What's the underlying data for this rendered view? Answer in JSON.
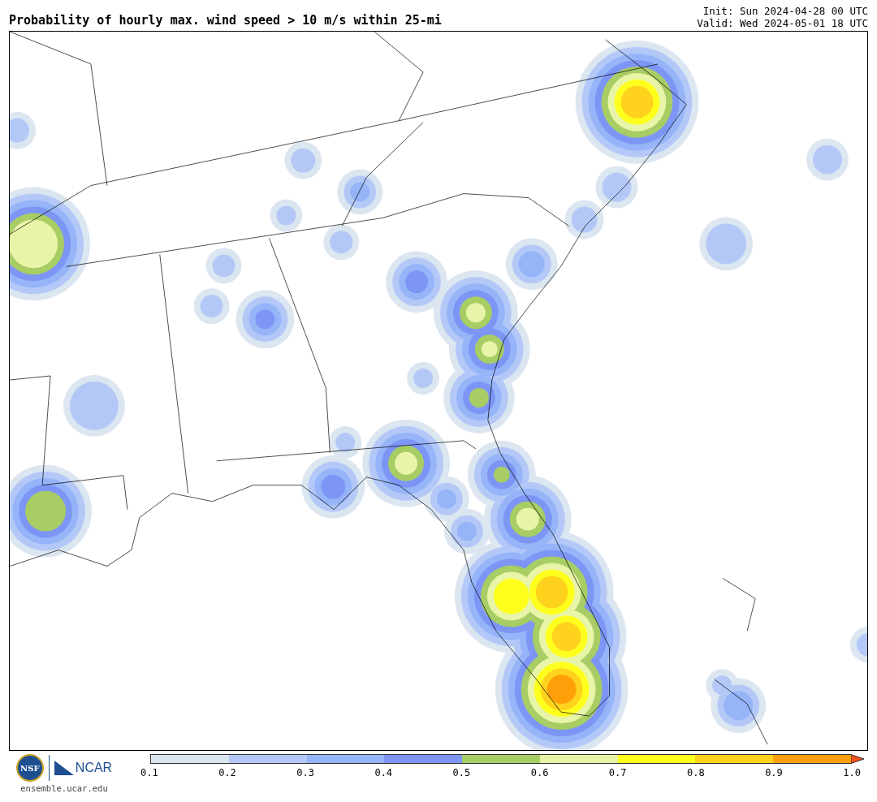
{
  "title": "Probability of hourly max. wind speed > 10 m/s within 25-mi",
  "init": "Init: Sun 2024-04-28 00 UTC",
  "valid": "Valid: Wed 2024-05-01 18 UTC",
  "logos": {
    "nsf": "NSF",
    "ncar": "NCAR",
    "site": "ensemble.ucar.edu"
  },
  "colorbar": {
    "bins": [
      {
        "kind": "block",
        "color": "#dbe6f0"
      },
      {
        "kind": "block",
        "color": "#b4c8f8"
      },
      {
        "kind": "block",
        "color": "#96b4f8"
      },
      {
        "kind": "block",
        "color": "#7d96f5"
      },
      {
        "kind": "block",
        "color": "#a8cd64"
      },
      {
        "kind": "block",
        "color": "#e8f5a8"
      },
      {
        "kind": "block",
        "color": "#ffff1e"
      },
      {
        "kind": "block",
        "color": "#ffd21e"
      },
      {
        "kind": "block",
        "color": "#ffa00a"
      },
      {
        "kind": "arrow",
        "color": "#f0501e"
      }
    ],
    "ticks": [
      "0.1",
      "0.2",
      "0.3",
      "0.4",
      "0.5",
      "0.6",
      "0.7",
      "0.8",
      "0.9",
      "1.0"
    ]
  }
}
